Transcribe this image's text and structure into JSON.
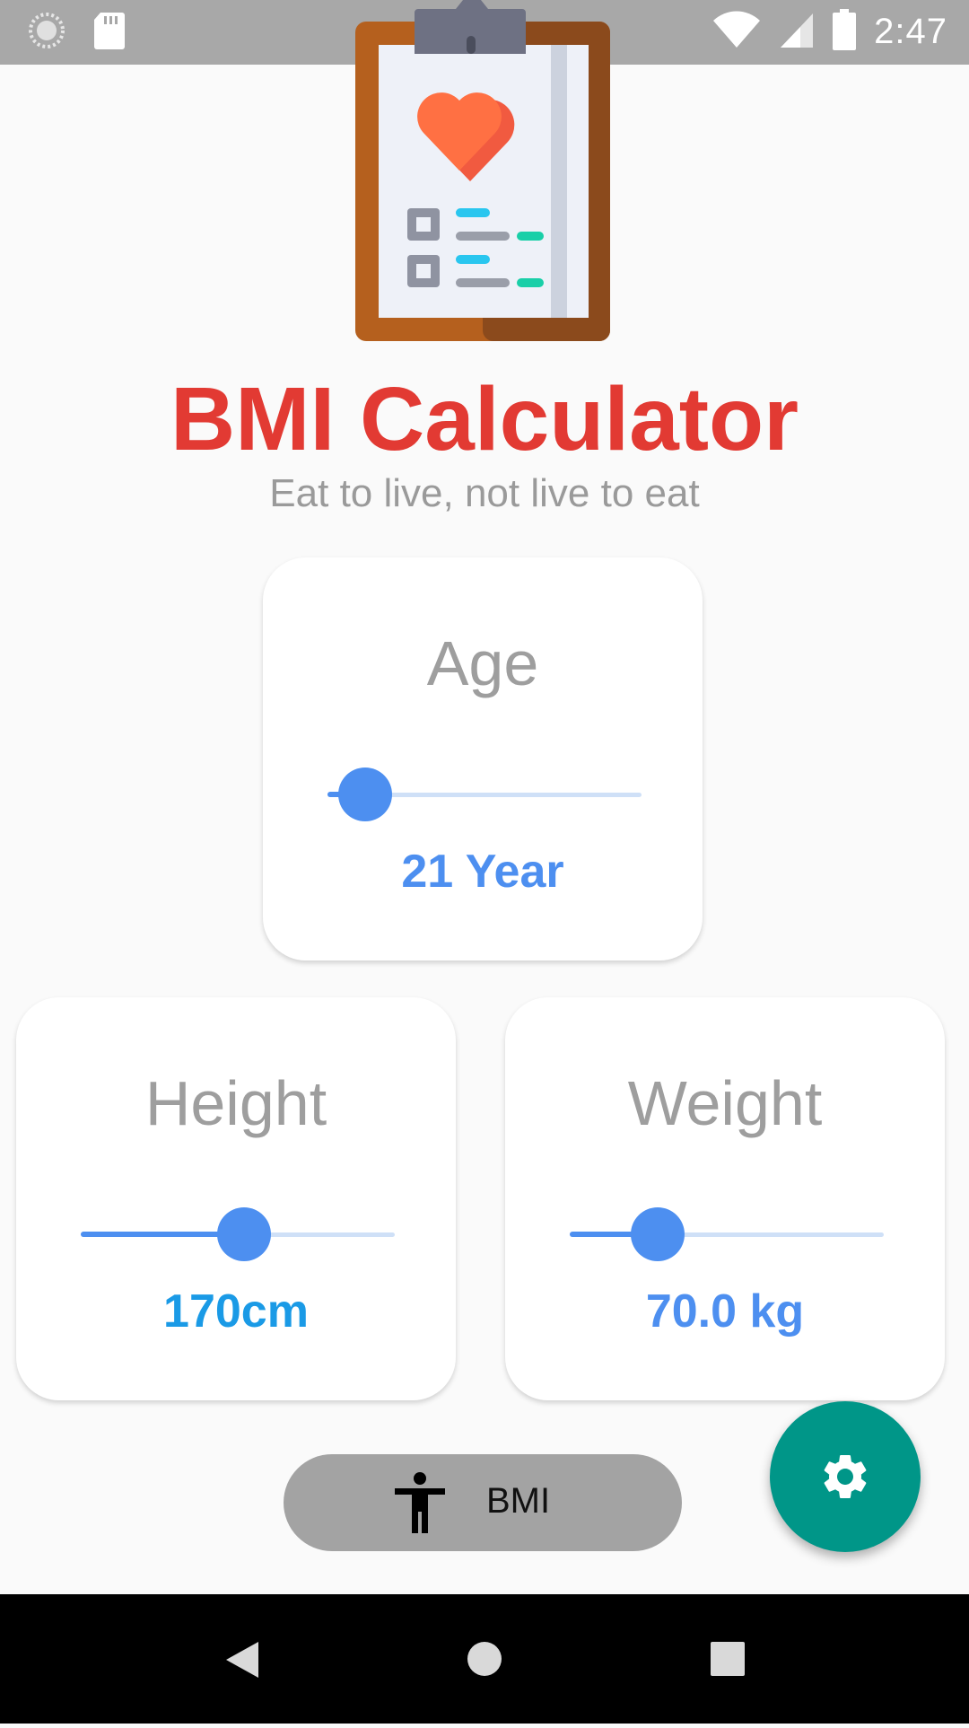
{
  "status_bar": {
    "time": "2:47",
    "icons": [
      "loading-icon",
      "sd-card-icon",
      "wifi-icon",
      "signal-icon",
      "battery-icon"
    ]
  },
  "header": {
    "logo_icon": "clipboard-heart-icon",
    "title": "BMI Calculator",
    "subtitle": "Eat to live, not live to eat"
  },
  "age": {
    "label": "Age",
    "value_text": "21 Year",
    "slider_fraction": 0.12,
    "color": "#4d8ff0"
  },
  "height": {
    "label": "Height",
    "value_text": "170cm",
    "slider_fraction": 0.52,
    "color": "#1a9ae6"
  },
  "weight": {
    "label": "Weight",
    "value_text": "70.0 kg",
    "slider_fraction": 0.28,
    "color": "#4d8ff0"
  },
  "bmi_button": {
    "label": "BMI",
    "icon": "accessibility-icon"
  },
  "fab": {
    "icon": "settings-icon",
    "color": "#009688"
  },
  "nav_bar": {
    "items": [
      "back-icon",
      "home-icon",
      "recents-icon"
    ]
  },
  "colors": {
    "title": "#e23a33",
    "subtitle": "#9a9a9a",
    "accent": "#4d8ff0",
    "background": "#fafafa"
  }
}
